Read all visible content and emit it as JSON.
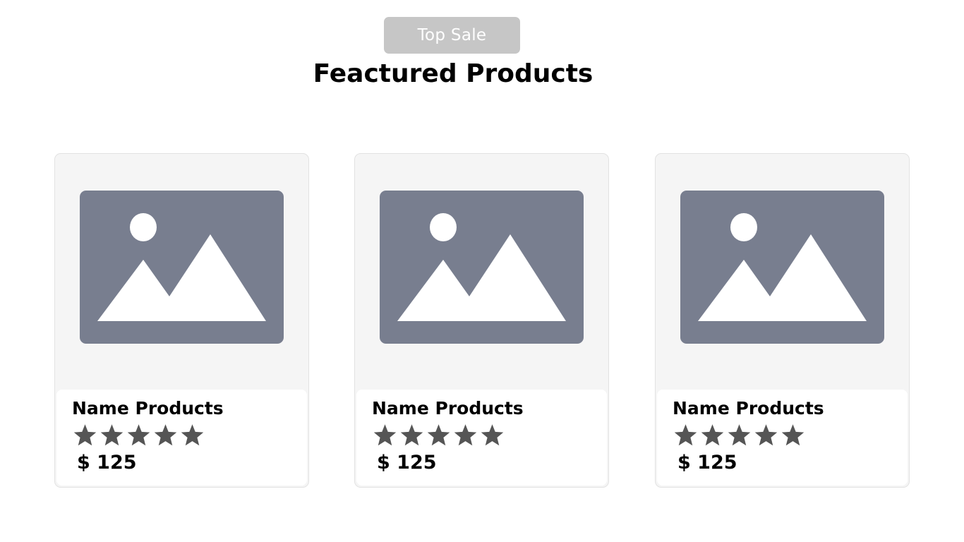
{
  "header": {
    "badge_label": "Top Sale",
    "title": "Feactured Products"
  },
  "products": [
    {
      "name": "Name Products",
      "rating": 5,
      "rating_max": 5,
      "price": "$ 125",
      "image_icon": "image-placeholder-icon"
    },
    {
      "name": "Name Products",
      "rating": 5,
      "rating_max": 5,
      "price": "$ 125",
      "image_icon": "image-placeholder-icon"
    },
    {
      "name": "Name Products",
      "rating": 5,
      "rating_max": 5,
      "price": "$ 125",
      "image_icon": "image-placeholder-icon"
    }
  ],
  "colors": {
    "badge_bg": "#c6c6c6",
    "card_bg": "#f5f5f5",
    "image_placeholder": "#787e8f",
    "star": "#555555"
  }
}
